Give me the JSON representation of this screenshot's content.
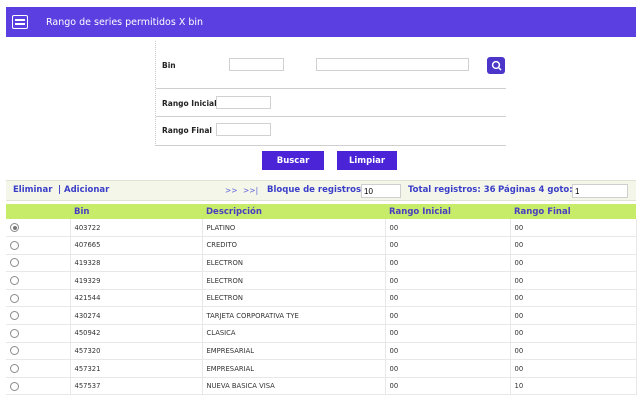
{
  "header": {
    "title": "Rango de series permitidos X bin",
    "icon": "list-icon"
  },
  "form": {
    "bin_label": "Bin",
    "rango_inicial_label": "Rango Inicial",
    "rango_final_label": "Rango Final",
    "bin_value": "",
    "description_value": "",
    "rango_inicial_value": "",
    "rango_final_value": ""
  },
  "buttons": {
    "buscar": "Buscar",
    "limpiar": "Limpiar"
  },
  "toolbar": {
    "eliminar": "Eliminar",
    "separator": "|",
    "adicionar": "Adicionar",
    "next": ">>",
    "last": ">>|",
    "bloque_label": "Bloque de registros:",
    "bloque_value": "10",
    "total_label": "Total registros: 36",
    "paginas_label": "Páginas 4 goto:",
    "goto_value": "1"
  },
  "table": {
    "columns": [
      "Bin",
      "Descripción",
      "Rango Inicial",
      "Rango Final"
    ],
    "rows": [
      {
        "selected": true,
        "bin": "403722",
        "descripcion": "PLATINO",
        "inicial": "00",
        "final": "00"
      },
      {
        "selected": false,
        "bin": "407665",
        "descripcion": "CREDITO",
        "inicial": "00",
        "final": "00"
      },
      {
        "selected": false,
        "bin": "419328",
        "descripcion": "ELECTRON",
        "inicial": "00",
        "final": "00"
      },
      {
        "selected": false,
        "bin": "419329",
        "descripcion": "ELECTRON",
        "inicial": "00",
        "final": "00"
      },
      {
        "selected": false,
        "bin": "421544",
        "descripcion": "ELECTRON",
        "inicial": "00",
        "final": "00"
      },
      {
        "selected": false,
        "bin": "430274",
        "descripcion": "TARJETA CORPORATIVA TYE",
        "inicial": "00",
        "final": "00"
      },
      {
        "selected": false,
        "bin": "450942",
        "descripcion": "CLASICA",
        "inicial": "00",
        "final": "00"
      },
      {
        "selected": false,
        "bin": "457320",
        "descripcion": "EMPRESARIAL",
        "inicial": "00",
        "final": "00"
      },
      {
        "selected": false,
        "bin": "457321",
        "descripcion": "EMPRESARIAL",
        "inicial": "00",
        "final": "00"
      },
      {
        "selected": false,
        "bin": "457537",
        "descripcion": "NUEVA BASICA VISA",
        "inicial": "00",
        "final": "10"
      }
    ]
  },
  "colors": {
    "header_bg": "#5b3fe0",
    "button_bg": "#4a24d6",
    "table_header_bg": "#c6ec6a",
    "link": "#3a3ec8"
  }
}
